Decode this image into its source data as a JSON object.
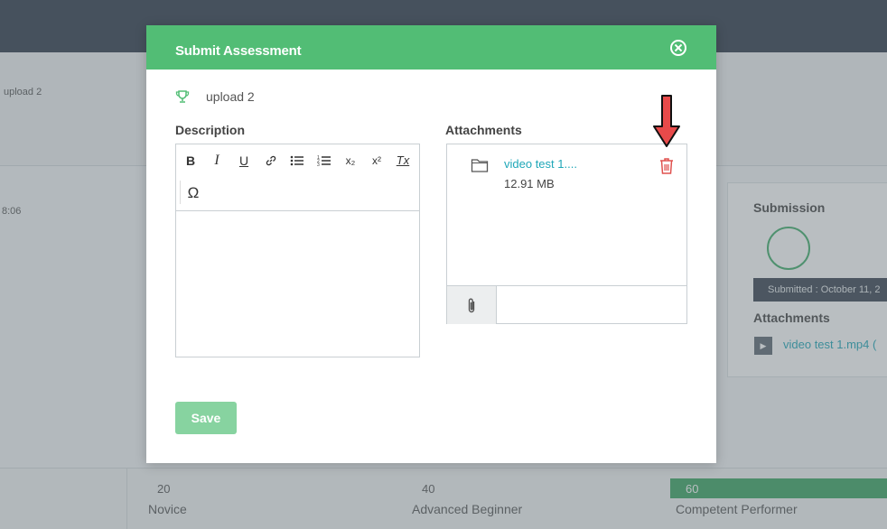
{
  "background": {
    "upload_label": "upload 2",
    "time_label": "8:06",
    "submission": {
      "title": "Submission",
      "submitted_text": "Submitted : October 11, 2",
      "attachments_title": "Attachments",
      "attachment_link": "video test 1.mp4 ("
    },
    "levels": [
      {
        "value": "20",
        "name": "Novice"
      },
      {
        "value": "40",
        "name": "Advanced Beginner"
      },
      {
        "value": "60",
        "name": "Competent Performer"
      }
    ]
  },
  "modal": {
    "title": "Submit Assessment",
    "task_name": "upload 2",
    "description_label": "Description",
    "attachments_label": "Attachments",
    "toolbar": {
      "bold": "B",
      "italic": "I",
      "underline": "U",
      "subscript": "x₂",
      "superscript": "x²",
      "clear_format": "Tx",
      "special_char": "Ω"
    },
    "attachment": {
      "file_name": "video test 1....",
      "file_size": "12.91 MB"
    },
    "save_label": "Save"
  },
  "colors": {
    "header_green": "#52bd75",
    "save_green": "#87d3a0",
    "link_teal": "#1fa7b8",
    "delete_red": "#e0524f",
    "annotation_arrow": "#e84a4a"
  },
  "icons": [
    "close-circle-icon",
    "trophy-icon",
    "link-icon",
    "bullet-list-icon",
    "numbered-list-icon",
    "folder-icon",
    "trash-icon",
    "paperclip-icon"
  ]
}
